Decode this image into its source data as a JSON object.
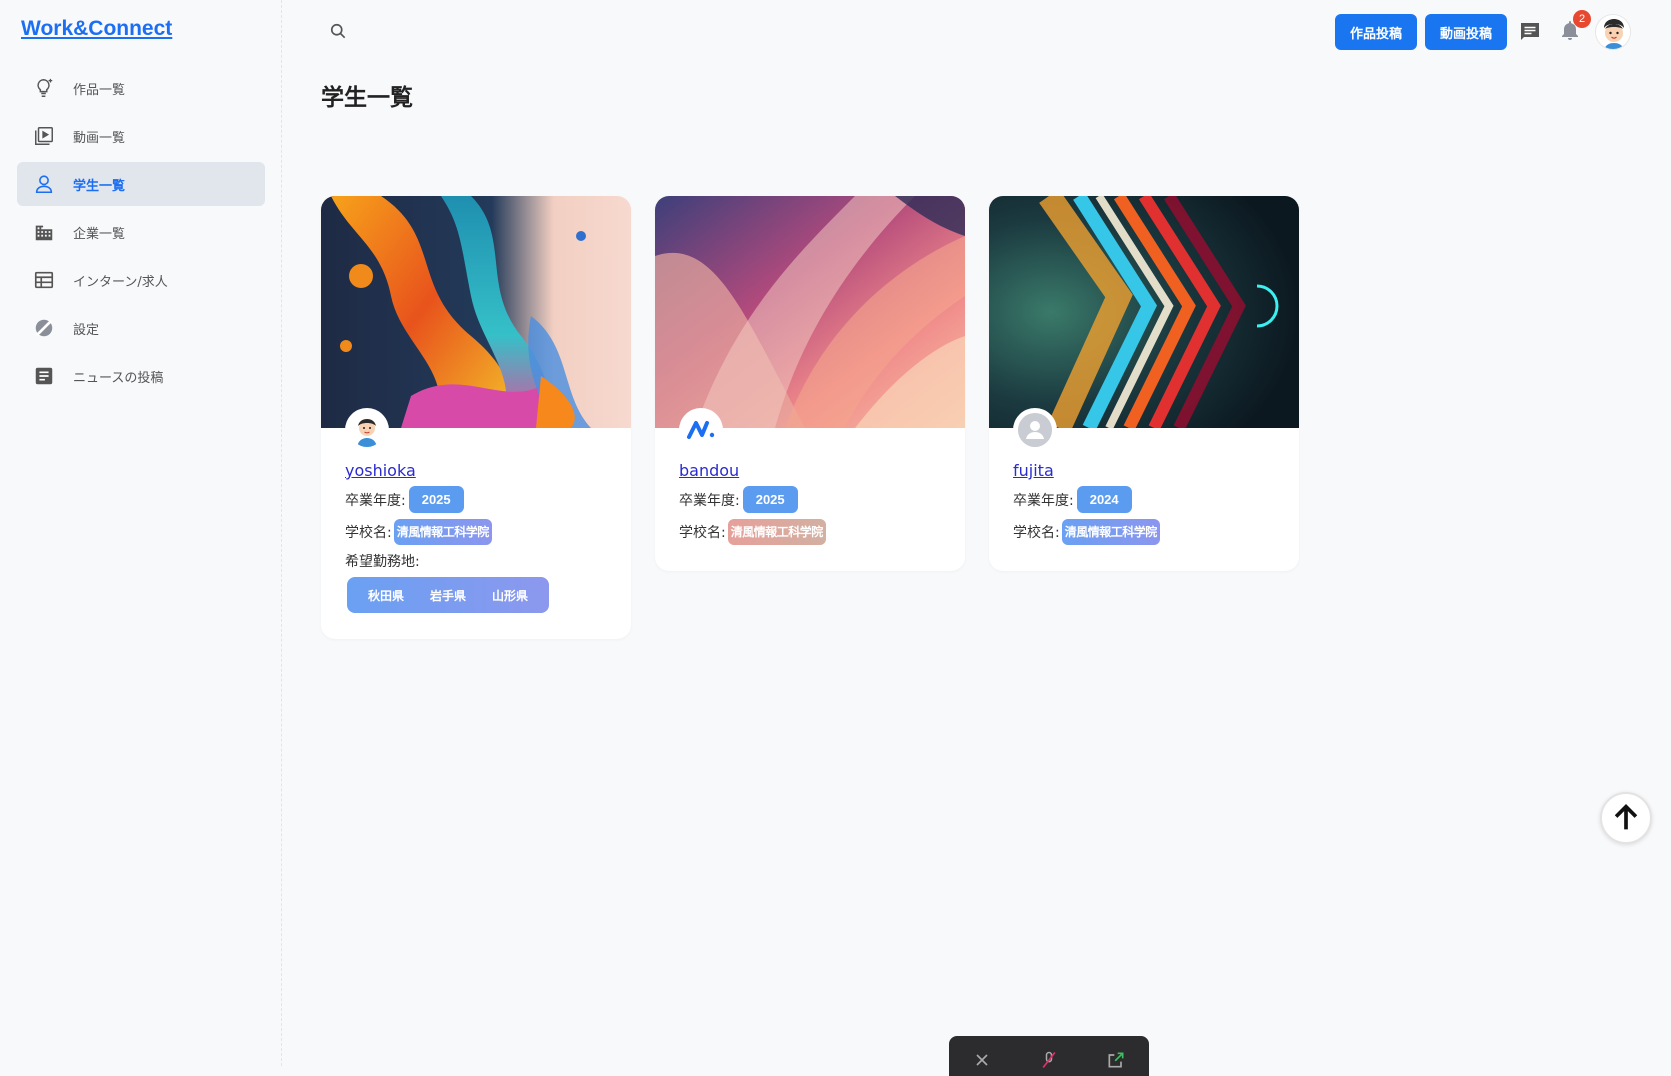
{
  "app": {
    "logo": "Work&Connect"
  },
  "sidebar": {
    "items": [
      {
        "label": "作品一覧",
        "icon": "lightbulb-icon"
      },
      {
        "label": "動画一覧",
        "icon": "video-library-icon"
      },
      {
        "label": "学生一覧",
        "icon": "person-icon",
        "active": true
      },
      {
        "label": "企業一覧",
        "icon": "building-icon"
      },
      {
        "label": "インターン/求人",
        "icon": "table-icon"
      },
      {
        "label": "設定",
        "icon": "settings-off-icon"
      },
      {
        "label": "ニュースの投稿",
        "icon": "post-add-icon"
      }
    ]
  },
  "header": {
    "post_work_label": "作品投稿",
    "post_video_label": "動画投稿",
    "notification_count": "2",
    "icons": [
      "search-icon",
      "chat-icon",
      "bell-icon",
      "user-avatar"
    ]
  },
  "main": {
    "title": "学生一覧",
    "students": [
      {
        "name": "yoshioka",
        "grad_label": "卒業年度:",
        "grad_year": "2025",
        "school_label": "学校名:",
        "school": "清風情報工科学院",
        "pref_label": "希望勤務地:",
        "prefs": [
          "秋田県",
          "岩手県",
          "山形県"
        ]
      },
      {
        "name": "bandou",
        "grad_label": "卒業年度:",
        "grad_year": "2025",
        "school_label": "学校名:",
        "school": "清風情報工科学院"
      },
      {
        "name": "fujita",
        "grad_label": "卒業年度:",
        "grad_year": "2024",
        "school_label": "学校名:",
        "school": "清風情報工科学院"
      }
    ]
  },
  "colors": {
    "accent": "#1976f0",
    "link": "#2a2bd0",
    "badge": "#e8482f",
    "chip": "#5b9cf0"
  }
}
